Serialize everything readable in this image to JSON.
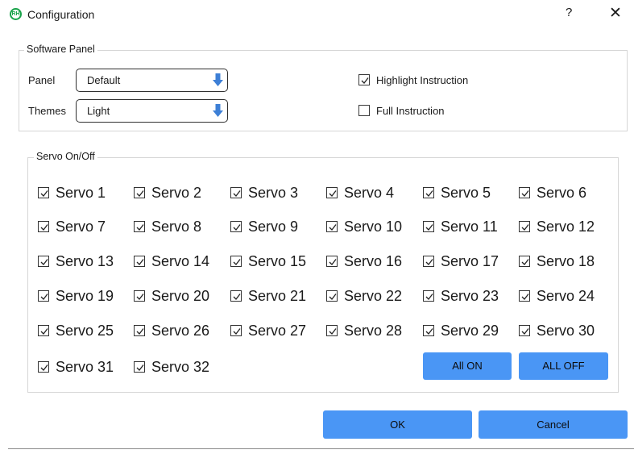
{
  "window": {
    "title": "Configuration",
    "help": "?",
    "close": "✕",
    "icon_text": "RH",
    "accent": "#4a96f5"
  },
  "software_panel": {
    "title": "Software Panel",
    "panel_label": "Panel",
    "panel_value": "Default",
    "themes_label": "Themes",
    "themes_value": "Light",
    "highlight_label": "Highlight Instruction",
    "highlight_checked": true,
    "full_label": "Full Instruction",
    "full_checked": false
  },
  "servo": {
    "title": "Servo On/Off",
    "items": [
      "Servo 1",
      "Servo 2",
      "Servo 3",
      "Servo 4",
      "Servo 5",
      "Servo 6",
      "Servo 7",
      "Servo 8",
      "Servo 9",
      "Servo 10",
      "Servo 11",
      "Servo 12",
      "Servo 13",
      "Servo 14",
      "Servo 15",
      "Servo 16",
      "Servo 17",
      "Servo 18",
      "Servo 19",
      "Servo 20",
      "Servo 21",
      "Servo 22",
      "Servo 23",
      "Servo 24",
      "Servo 25",
      "Servo 26",
      "Servo 27",
      "Servo 28",
      "Servo 29",
      "Servo 30",
      "Servo 31",
      "Servo 32"
    ],
    "all_checked": true,
    "all_on": "All ON",
    "all_off": "ALL OFF"
  },
  "footer": {
    "ok": "OK",
    "cancel": "Cancel"
  }
}
